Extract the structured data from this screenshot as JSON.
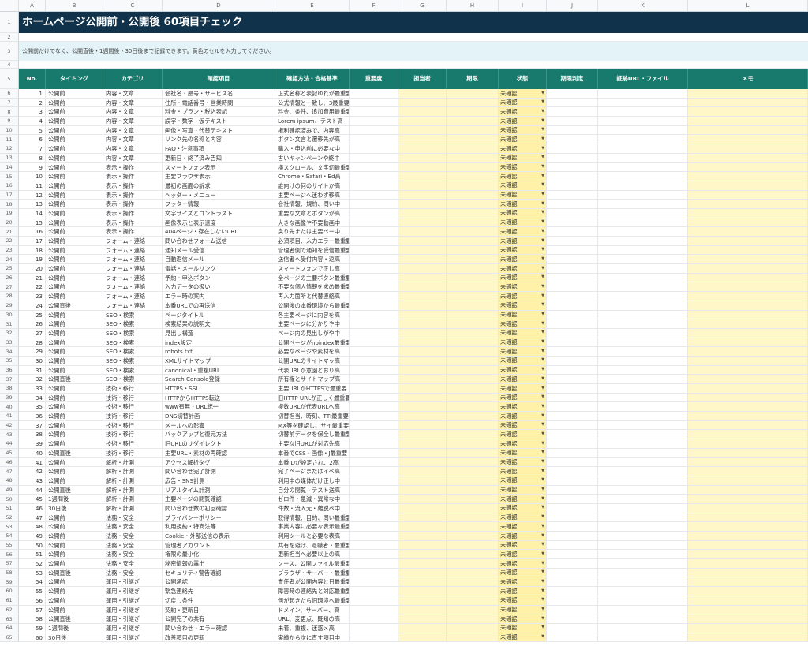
{
  "column_letters": [
    "A",
    "B",
    "C",
    "D",
    "E",
    "F",
    "G",
    "H",
    "I",
    "J",
    "K",
    "L"
  ],
  "title": "ホームページ公開前・公開後 60項目チェック",
  "note": "公開前だけでなく、公開直後・1週間後・30日後まで記録できます。黄色のセルを入力してください。",
  "headers": [
    "No.",
    "タイミング",
    "カテゴリ",
    "確認項目",
    "確認方法・合格基準",
    "重要度",
    "担当者",
    "期限",
    "状態",
    "期限判定",
    "証跡URL・ファイル",
    "メモ"
  ],
  "status_default": "未確認",
  "dropdown_icon": "triangle-down-icon",
  "colors": {
    "title_bg": "#10324a",
    "header_bg": "#177a6c",
    "note_bg": "#e4f3f8",
    "input_bg": "#fff7c8",
    "status_bg": "#fff2a8"
  },
  "rows": [
    [
      "1",
      "公開前",
      "内容・文章",
      "会社名・屋号・サービス名",
      "正式名称と表記ゆれが最重要"
    ],
    [
      "2",
      "公開前",
      "内容・文章",
      "住所・電話番号・営業時間",
      "公式情報と一致し、3最重要"
    ],
    [
      "3",
      "公開前",
      "内容・文章",
      "料金・プラン・税込表記",
      "料金、条件、追加費用最重要"
    ],
    [
      "4",
      "公開前",
      "内容・文章",
      "誤字・数字・仮テキスト",
      "Lorem ipsum、テスト高"
    ],
    [
      "5",
      "公開前",
      "内容・文章",
      "画像・写真・代替テキスト",
      "権利確認済みで、内容高"
    ],
    [
      "6",
      "公開前",
      "内容・文章",
      "リンク先の名称と内容",
      "ボタン文言と遷移先が高"
    ],
    [
      "7",
      "公開前",
      "内容・文章",
      "FAQ・注意事項",
      "購入・申込前に必要な中"
    ],
    [
      "8",
      "公開前",
      "内容・文章",
      "更新日・終了済み告知",
      "古いキャンペーンや終中"
    ],
    [
      "9",
      "公開前",
      "表示・操作",
      "スマートフォン表示",
      "横スクロール、文字切最重要"
    ],
    [
      "10",
      "公開前",
      "表示・操作",
      "主要ブラウザ表示",
      "Chrome・Safari・Ed高"
    ],
    [
      "11",
      "公開前",
      "表示・操作",
      "最初の画面の訴求",
      "誰向けの何のサイトか高"
    ],
    [
      "12",
      "公開前",
      "表示・操作",
      "ヘッダー・メニュー",
      "主要ページへ迷わず移高"
    ],
    [
      "13",
      "公開前",
      "表示・操作",
      "フッター情報",
      "会社情報、規約、問い中"
    ],
    [
      "14",
      "公開前",
      "表示・操作",
      "文字サイズとコントラスト",
      "重要な文章とボタンが高"
    ],
    [
      "15",
      "公開前",
      "表示・操作",
      "画像表示と表示速度",
      "大きな画像や不要動画中"
    ],
    [
      "16",
      "公開前",
      "表示・操作",
      "404ページ・存在しないURL",
      "戻り先または主要ペー中"
    ],
    [
      "17",
      "公開前",
      "フォーム・連絡",
      "問い合わせフォーム送信",
      "必須項目、入力エラー最重要"
    ],
    [
      "18",
      "公開前",
      "フォーム・連絡",
      "通知メール受信",
      "管理者側で通知を受信最重要"
    ],
    [
      "19",
      "公開前",
      "フォーム・連絡",
      "自動返信メール",
      "送信者へ受付内容・返高"
    ],
    [
      "20",
      "公開前",
      "フォーム・連絡",
      "電話・メールリンク",
      "スマートフォンで正し高"
    ],
    [
      "21",
      "公開前",
      "フォーム・連絡",
      "予約・申込ボタン",
      "全ページの主要ボタン最重要"
    ],
    [
      "22",
      "公開前",
      "フォーム・連絡",
      "入力データの扱い",
      "不要な個人情報を求め最重要"
    ],
    [
      "23",
      "公開前",
      "フォーム・連絡",
      "エラー時の案内",
      "再入力箇所と代替連絡高"
    ],
    [
      "24",
      "公開直後",
      "フォーム・連絡",
      "本番URLでの再送信",
      "公開後の本番環境から最重要"
    ],
    [
      "25",
      "公開前",
      "SEO・検索",
      "ページタイトル",
      "各主要ページに内容を高"
    ],
    [
      "26",
      "公開前",
      "SEO・検索",
      "検索結果の説明文",
      "主要ページに分かりや中"
    ],
    [
      "27",
      "公開前",
      "SEO・検索",
      "見出し構造",
      "ページ内の見出しがや中"
    ],
    [
      "28",
      "公開前",
      "SEO・検索",
      "index設定",
      "公開ページがnoindex最重要"
    ],
    [
      "29",
      "公開前",
      "SEO・検索",
      "robots.txt",
      "必要なページや素材を高"
    ],
    [
      "30",
      "公開前",
      "SEO・検索",
      "XMLサイトマップ",
      "公開URLのサイトマッ高"
    ],
    [
      "31",
      "公開前",
      "SEO・検索",
      "canonical・重複URL",
      "代表URLが意図どおり高"
    ],
    [
      "32",
      "公開直後",
      "SEO・検索",
      "Search Console登録",
      "所有権とサイトマップ高"
    ],
    [
      "33",
      "公開前",
      "技術・移行",
      "HTTPS・SSL",
      "主要URLがHTTPSで最重要"
    ],
    [
      "34",
      "公開前",
      "技術・移行",
      "HTTPからHTTPS転送",
      "旧HTTP URLが正しく最重要"
    ],
    [
      "35",
      "公開前",
      "技術・移行",
      "www有無・URL統一",
      "複数URLが代表URLへ高"
    ],
    [
      "36",
      "公開前",
      "技術・移行",
      "DNS切替計画",
      "切替担当、時刻、TTI最重要"
    ],
    [
      "37",
      "公開前",
      "技術・移行",
      "メールへの影響",
      "MX等を確認し、サイ最重要"
    ],
    [
      "38",
      "公開前",
      "技術・移行",
      "バックアップと復元方法",
      "切替前データを保全し最重要"
    ],
    [
      "39",
      "公開前",
      "技術・移行",
      "旧URLのリダイレクト",
      "主要な旧URLが対応先高"
    ],
    [
      "40",
      "公開直後",
      "技術・移行",
      "主要URL・素材の再確認",
      "本番でCSS・画像・J最重要"
    ],
    [
      "41",
      "公開前",
      "解析・計測",
      "アクセス解析タグ",
      "本番IDが設定され、2高"
    ],
    [
      "42",
      "公開前",
      "解析・計測",
      "問い合わせ完了計測",
      "完了ページまたはイベ高"
    ],
    [
      "43",
      "公開前",
      "解析・計測",
      "広告・SNS計測",
      "利用中の媒体だけ正し中"
    ],
    [
      "44",
      "公開直後",
      "解析・計測",
      "リアルタイム計測",
      "自分の閲覧・テスト送高"
    ],
    [
      "45",
      "1週間後",
      "解析・計測",
      "主要ページの閲覧確認",
      "ゼロ件・急減・異常な中"
    ],
    [
      "46",
      "30日後",
      "解析・計測",
      "問い合わせ数の初回確認",
      "件数・流入元・離脱ペ中"
    ],
    [
      "47",
      "公開前",
      "法務・安全",
      "プライバシーポリシー",
      "取得情報、目的、問い最重要"
    ],
    [
      "48",
      "公開前",
      "法務・安全",
      "利用規約・特商法等",
      "事業内容に必要な表示最重要"
    ],
    [
      "49",
      "公開前",
      "法務・安全",
      "Cookie・外部送信の表示",
      "利用ツールと必要な表高"
    ],
    [
      "50",
      "公開前",
      "法務・安全",
      "管理者アカウント",
      "共有を避け、退職者・最重要"
    ],
    [
      "51",
      "公開前",
      "法務・安全",
      "権限の最小化",
      "更新担当へ必要以上の高"
    ],
    [
      "52",
      "公開前",
      "法務・安全",
      "秘密情報の露出",
      "ソース、公開ファイル最重要"
    ],
    [
      "53",
      "公開直後",
      "法務・安全",
      "セキュリティ警告確認",
      "ブラウザ・サーバー・最重要"
    ],
    [
      "54",
      "公開前",
      "運用・引継ぎ",
      "公開承認",
      "責任者が公開内容と日最重要"
    ],
    [
      "55",
      "公開前",
      "運用・引継ぎ",
      "緊急連絡先",
      "障害時の連絡先と対応最重要"
    ],
    [
      "56",
      "公開前",
      "運用・引継ぎ",
      "切戻し条件",
      "何が起きたら旧環境へ最重要"
    ],
    [
      "57",
      "公開前",
      "運用・引継ぎ",
      "契約・更新日",
      "ドメイン、サーバー、高"
    ],
    [
      "58",
      "公開直後",
      "運用・引継ぎ",
      "公開完了の共有",
      "URL、変更点、既知の高"
    ],
    [
      "59",
      "1週間後",
      "運用・引継ぎ",
      "問い合わせ・エラー確認",
      "未着、重複、迷惑メ高"
    ],
    [
      "60",
      "30日後",
      "運用・引継ぎ",
      "改善項目の更新",
      "実績から次に直す項目中"
    ]
  ]
}
